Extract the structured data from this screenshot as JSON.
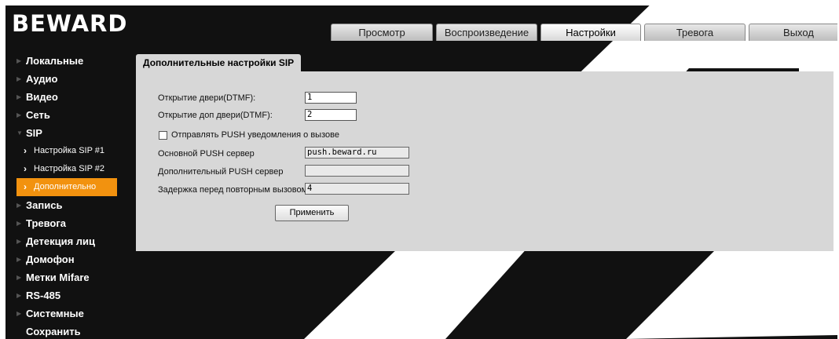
{
  "logo": "BEWARD",
  "tabs": [
    {
      "label": "Просмотр",
      "active": false
    },
    {
      "label": "Воспроизведение",
      "active": false
    },
    {
      "label": "Настройки",
      "active": true
    },
    {
      "label": "Тревога",
      "active": false
    },
    {
      "label": "Выход",
      "active": false
    }
  ],
  "sidebar": {
    "items": [
      {
        "label": "Локальные"
      },
      {
        "label": "Аудио"
      },
      {
        "label": "Видео"
      },
      {
        "label": "Сеть"
      },
      {
        "label": "SIP",
        "expanded": true,
        "children": [
          {
            "label": "Настройка SIP #1"
          },
          {
            "label": "Настройка SIP #2"
          },
          {
            "label": "Дополнительно",
            "active": true
          }
        ]
      },
      {
        "label": "Запись"
      },
      {
        "label": "Тревога"
      },
      {
        "label": "Детекция лиц"
      },
      {
        "label": "Домофон"
      },
      {
        "label": "Метки Mifare"
      },
      {
        "label": "RS-485"
      },
      {
        "label": "Системные"
      },
      {
        "label": "Сохранить"
      }
    ]
  },
  "panel": {
    "title": "Дополнительные настройки SIP",
    "door_dtmf_label": "Открытие двери(DTMF):",
    "door_dtmf_value": "1",
    "extra_door_dtmf_label": "Открытие доп двери(DTMF):",
    "extra_door_dtmf_value": "2",
    "push_checkbox_label": "Отправлять PUSH уведомления о вызове",
    "push_checkbox_checked": false,
    "main_push_label": "Основной PUSH сервер",
    "main_push_value": "push.beward.ru",
    "extra_push_label": "Дополнительный PUSH сервер",
    "extra_push_value": "",
    "redial_delay_label": "Задержка перед повторным вызовом",
    "redial_delay_value": "4",
    "apply_label": "Применить"
  },
  "colors": {
    "background": "#111111",
    "panel": "#d7d7d7",
    "active_submenu": "#f2920f"
  }
}
